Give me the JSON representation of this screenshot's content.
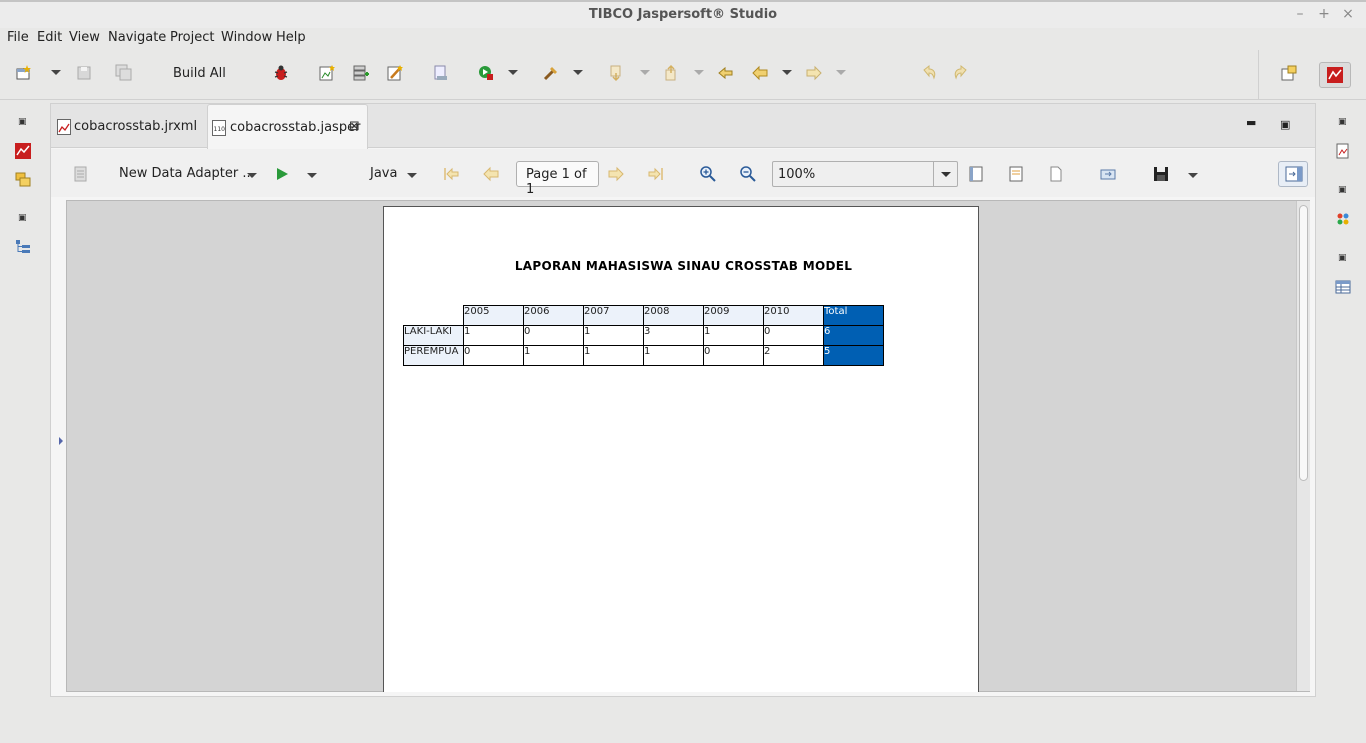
{
  "window": {
    "title": "TIBCO Jaspersoft® Studio"
  },
  "menu": [
    "File",
    "Edit",
    "View",
    "Navigate",
    "Project",
    "Window",
    "Help"
  ],
  "toolbar": {
    "build_all": "Build All"
  },
  "tabs": [
    {
      "label": "cobacrosstab.jrxml",
      "active": false
    },
    {
      "label": "cobacrosstab.jasper",
      "active": true
    }
  ],
  "preview": {
    "adapter": "New Data Adapter ...",
    "format": "Java",
    "page": "Page 1 of 1",
    "zoom": "100%"
  },
  "report": {
    "title": "LAPORAN MAHASISWA SINAU CROSSTAB MODEL",
    "columns": [
      "2005",
      "2006",
      "2007",
      "2008",
      "2009",
      "2010",
      "Total"
    ],
    "rows": [
      {
        "label": "LAKI-LAKI",
        "values": [
          "1",
          "0",
          "1",
          "3",
          "1",
          "0",
          "6"
        ]
      },
      {
        "label": "PEREMPUA",
        "values": [
          "0",
          "1",
          "1",
          "1",
          "0",
          "2",
          "5"
        ]
      }
    ]
  },
  "colors": {
    "total_cell": "#005fb3",
    "header_cell": "#ecf2fa"
  }
}
